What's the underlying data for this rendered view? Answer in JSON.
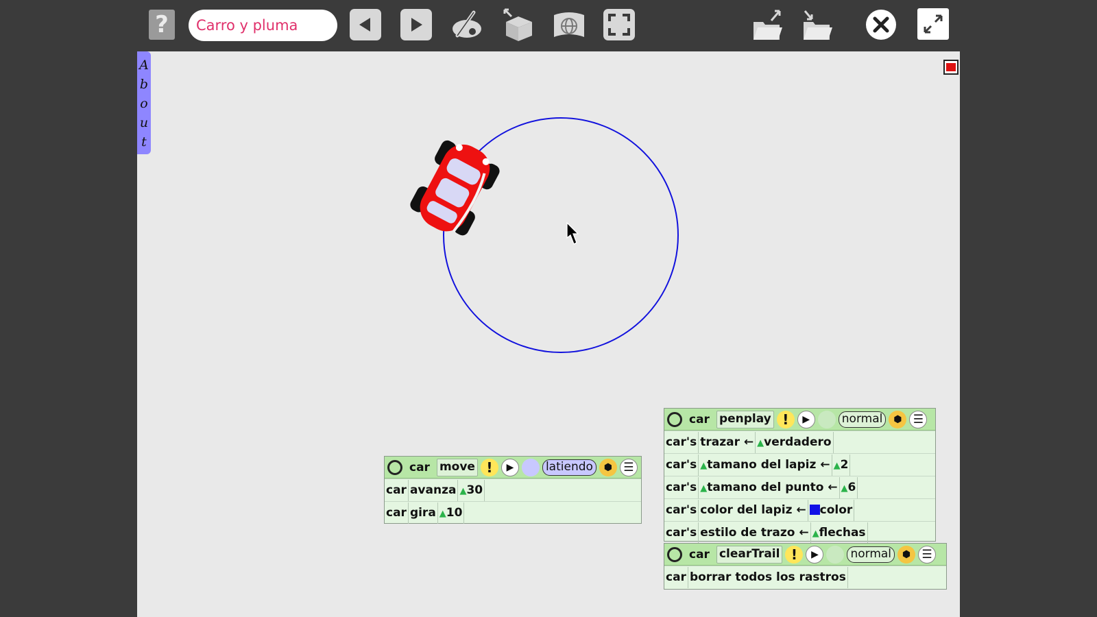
{
  "toolbar": {
    "help_label": "?",
    "project_title": "Carro y pluma"
  },
  "world": {
    "about_letters": [
      "A",
      "b",
      "o",
      "u",
      "t"
    ],
    "pen_color": "#1111dd",
    "car_color": "#ee1111"
  },
  "scripts": {
    "move": {
      "player": "car",
      "name": "move",
      "tick_mode": "latiendo",
      "rows": [
        {
          "player": "car",
          "command": "avanza",
          "value": "30"
        },
        {
          "player": "car",
          "command": "gira",
          "value": "10"
        }
      ]
    },
    "penplay": {
      "player": "car",
      "name": "penplay",
      "tick_mode": "normal",
      "rows": [
        {
          "player": "car's",
          "slot": "trazar",
          "value": "verdadero"
        },
        {
          "player": "car's",
          "slot": "tamano del lapiz",
          "value": "2"
        },
        {
          "player": "car's",
          "slot": "tamano del punto",
          "value": "6"
        },
        {
          "player": "car's",
          "slot": "color del lapiz",
          "value": "color"
        },
        {
          "player": "car's",
          "slot": "estilo de trazo",
          "value": "flechas"
        }
      ]
    },
    "clearTrail": {
      "player": "car",
      "name": "clearTrail",
      "tick_mode": "normal",
      "rows": [
        {
          "player": "car",
          "command": "borrar todos los rastros"
        }
      ]
    }
  }
}
